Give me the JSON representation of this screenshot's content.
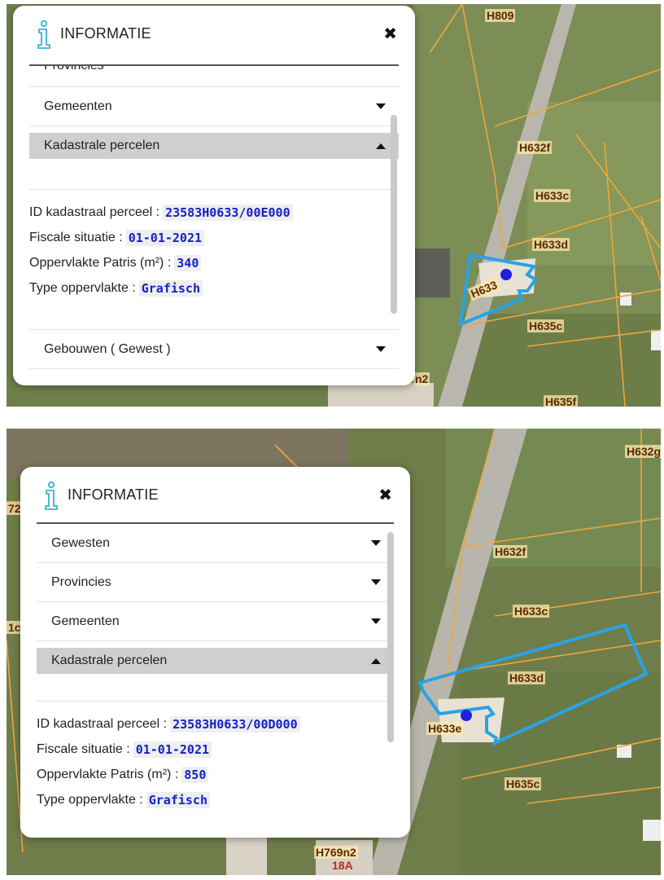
{
  "top_screenshot": {
    "panel": {
      "title": "INFORMATIE",
      "close_symbol": "✖",
      "cut_item_label": "Provincies",
      "items": [
        {
          "label": "Gemeenten",
          "state": "collapsed"
        },
        {
          "label": "Kadastrale percelen",
          "state": "expanded"
        },
        {
          "label": "Gebouwen ( Gewest )",
          "state": "collapsed"
        }
      ],
      "details": [
        {
          "label": "ID kadastraal perceel :",
          "value": "23583H0633/00E000"
        },
        {
          "label": "Fiscale situatie :",
          "value": "01-01-2021"
        },
        {
          "label": "Oppervlakte Patris (m²) :",
          "value": "340"
        },
        {
          "label": "Type oppervlakte :",
          "value": "Grafisch"
        }
      ]
    },
    "map_labels": [
      "H809",
      "H632f",
      "H633c",
      "H633d",
      "H633",
      "H635c",
      "H635f",
      "n2"
    ]
  },
  "bottom_screenshot": {
    "panel": {
      "title": "INFORMATIE",
      "close_symbol": "✖",
      "items": [
        {
          "label": "Gewesten",
          "state": "collapsed"
        },
        {
          "label": "Provincies",
          "state": "collapsed"
        },
        {
          "label": "Gemeenten",
          "state": "collapsed"
        },
        {
          "label": "Kadastrale percelen",
          "state": "expanded"
        }
      ],
      "details": [
        {
          "label": "ID kadastraal perceel :",
          "value": "23583H0633/00D000"
        },
        {
          "label": "Fiscale situatie :",
          "value": "01-01-2021"
        },
        {
          "label": "Oppervlakte Patris (m²) :",
          "value": "850"
        },
        {
          "label": "Type oppervlakte :",
          "value": "Grafisch"
        }
      ]
    },
    "map_labels": [
      "H632g",
      "H632f",
      "H633c",
      "H633d",
      "H633e",
      "H635c",
      "H769n2",
      "18A",
      "72",
      "1c"
    ]
  },
  "colors": {
    "selection_outline": "#29a3e6",
    "parcel_boundary": "#f0a63a",
    "selection_dot": "#1f1fdc",
    "value_text": "#1521c7",
    "info_icon": "#39b0d6"
  }
}
